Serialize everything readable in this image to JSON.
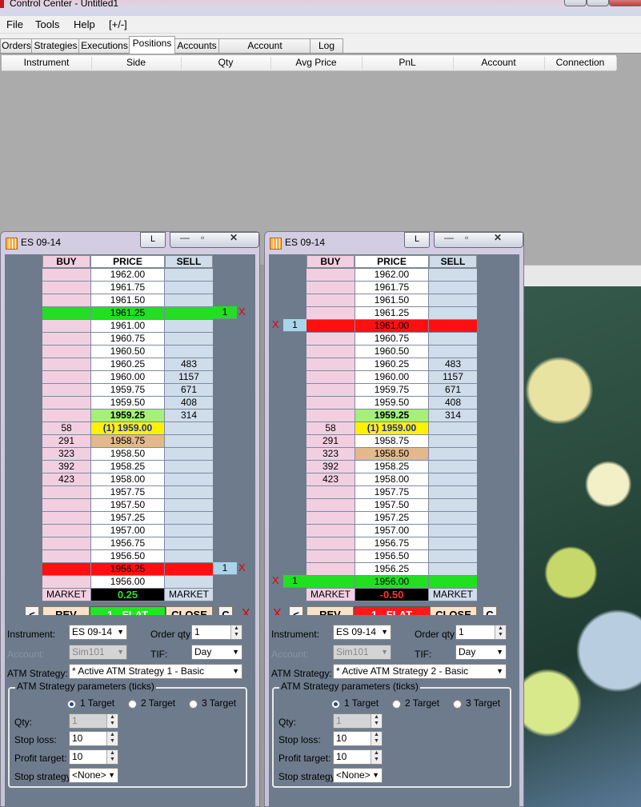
{
  "window": {
    "title": "Control Center - Untitled1"
  },
  "menu": [
    "File",
    "Tools",
    "Help",
    "[+/-]"
  ],
  "tabs": [
    "Orders",
    "Strategies",
    "Executions",
    "Positions",
    "Accounts",
    "Account Performance",
    "Log"
  ],
  "active_tab": "Positions",
  "grid": {
    "columns": [
      "Instrument",
      "Side",
      "Qty",
      "Avg Price",
      "PnL",
      "Account",
      "Connection"
    ]
  },
  "doms": [
    {
      "title": "ES 09-14",
      "lock": "L",
      "headers": {
        "buy": "BUY",
        "price": "PRICE",
        "sell": "SELL"
      },
      "rows": [
        {
          "p": "1962.00",
          "b": "",
          "s": ""
        },
        {
          "p": "1961.75",
          "b": "",
          "s": ""
        },
        {
          "p": "1961.50",
          "b": "",
          "s": ""
        },
        {
          "p": "1961.25",
          "b": "",
          "s": "",
          "hl": "green",
          "right_order": "1"
        },
        {
          "p": "1961.00",
          "b": "",
          "s": ""
        },
        {
          "p": "1960.75",
          "b": "",
          "s": ""
        },
        {
          "p": "1960.50",
          "b": "",
          "s": ""
        },
        {
          "p": "1960.25",
          "b": "",
          "s": "483"
        },
        {
          "p": "1960.00",
          "b": "",
          "s": "1157"
        },
        {
          "p": "1959.75",
          "b": "",
          "s": "671"
        },
        {
          "p": "1959.50",
          "b": "",
          "s": "408"
        },
        {
          "p": "1959.25",
          "b": "",
          "s": "314",
          "pstyle": "ask"
        },
        {
          "p": "(1) 1959.00",
          "b": "58",
          "s": "",
          "pstyle": "last"
        },
        {
          "p": "1958.75",
          "b": "291",
          "s": "",
          "pstyle": "tan"
        },
        {
          "p": "1958.50",
          "b": "323",
          "s": ""
        },
        {
          "p": "1958.25",
          "b": "392",
          "s": ""
        },
        {
          "p": "1958.00",
          "b": "423",
          "s": ""
        },
        {
          "p": "1957.75",
          "b": "",
          "s": ""
        },
        {
          "p": "1957.50",
          "b": "",
          "s": ""
        },
        {
          "p": "1957.25",
          "b": "",
          "s": ""
        },
        {
          "p": "1957.00",
          "b": "",
          "s": ""
        },
        {
          "p": "1956.75",
          "b": "",
          "s": ""
        },
        {
          "p": "1956.50",
          "b": "",
          "s": ""
        },
        {
          "p": "1956.25",
          "b": "",
          "s": "",
          "hl": "red",
          "right_order": "1"
        },
        {
          "p": "1956.00",
          "b": "",
          "s": ""
        }
      ],
      "market_buy": "MARKET",
      "pnl": "0.25",
      "pnl_color": "#2fe02f",
      "market_sell": "MARKET",
      "controls": {
        "left": "<",
        "rev": "REV",
        "flat": "1 - FLAT",
        "flat_bg": "#22e622",
        "close": "CLOSE",
        "c": "C",
        "x": "X",
        "x_side": "right"
      },
      "form": {
        "instrument_label": "Instrument:",
        "instrument": "ES 09-14",
        "orderqty_label": "Order qty:",
        "orderqty": "1",
        "account_label": "Account:",
        "account": "Sim101",
        "tif_label": "TIF:",
        "tif": "Day",
        "atm_label": "ATM Strategy:",
        "atm": "* Active ATM Strategy 1 - Basic",
        "params_title": "ATM Strategy parameters (ticks)",
        "targets": [
          "1 Target",
          "2 Target",
          "3 Target"
        ],
        "qty_label": "Qty:",
        "qty": "1",
        "stoploss_label": "Stop loss:",
        "stoploss": "10",
        "profit_label": "Profit target:",
        "profit": "10",
        "stopstrat_label": "Stop strategy:",
        "stopstrat": "<None>"
      }
    },
    {
      "title": "ES 09-14",
      "lock": "L",
      "headers": {
        "buy": "BUY",
        "price": "PRICE",
        "sell": "SELL"
      },
      "rows": [
        {
          "p": "1962.00",
          "b": "",
          "s": ""
        },
        {
          "p": "1961.75",
          "b": "",
          "s": ""
        },
        {
          "p": "1961.50",
          "b": "",
          "s": ""
        },
        {
          "p": "1961.25",
          "b": "",
          "s": ""
        },
        {
          "p": "1961.00",
          "b": "",
          "s": "",
          "hl": "red",
          "left_order": "1"
        },
        {
          "p": "1960.75",
          "b": "",
          "s": ""
        },
        {
          "p": "1960.50",
          "b": "",
          "s": ""
        },
        {
          "p": "1960.25",
          "b": "",
          "s": "483"
        },
        {
          "p": "1960.00",
          "b": "",
          "s": "1157"
        },
        {
          "p": "1959.75",
          "b": "",
          "s": "671"
        },
        {
          "p": "1959.50",
          "b": "",
          "s": "408"
        },
        {
          "p": "1959.25",
          "b": "",
          "s": "314",
          "pstyle": "ask"
        },
        {
          "p": "(1) 1959.00",
          "b": "58",
          "s": "",
          "pstyle": "last"
        },
        {
          "p": "1958.75",
          "b": "291",
          "s": ""
        },
        {
          "p": "1958.50",
          "b": "323",
          "s": "",
          "pstyle": "tan"
        },
        {
          "p": "1958.25",
          "b": "392",
          "s": ""
        },
        {
          "p": "1958.00",
          "b": "423",
          "s": ""
        },
        {
          "p": "1957.75",
          "b": "",
          "s": ""
        },
        {
          "p": "1957.50",
          "b": "",
          "s": ""
        },
        {
          "p": "1957.25",
          "b": "",
          "s": ""
        },
        {
          "p": "1957.00",
          "b": "",
          "s": ""
        },
        {
          "p": "1956.75",
          "b": "",
          "s": ""
        },
        {
          "p": "1956.50",
          "b": "",
          "s": ""
        },
        {
          "p": "1956.25",
          "b": "",
          "s": ""
        },
        {
          "p": "1956.00",
          "b": "",
          "s": "",
          "hl": "green",
          "left_order": "1"
        }
      ],
      "market_buy": "MARKET",
      "pnl": "-0.50",
      "pnl_color": "#ff3030",
      "market_sell": "MARKET",
      "controls": {
        "left": "<",
        "rev": "REV",
        "flat": "1 - FLAT",
        "flat_bg": "#ff1818",
        "close": "CLOSE",
        "c": "C",
        "x": "X",
        "x_side": "left"
      },
      "form": {
        "instrument_label": "Instrument:",
        "instrument": "ES 09-14",
        "orderqty_label": "Order qty:",
        "orderqty": "1",
        "account_label": "Account:",
        "account": "Sim101",
        "tif_label": "TIF:",
        "tif": "Day",
        "atm_label": "ATM Strategy:",
        "atm": "* Active ATM Strategy 2 - Basic",
        "params_title": "ATM Strategy parameters (ticks)",
        "targets": [
          "1 Target",
          "2 Target",
          "3 Target"
        ],
        "qty_label": "Qty:",
        "qty": "1",
        "stoploss_label": "Stop loss:",
        "stoploss": "10",
        "profit_label": "Profit target:",
        "profit": "10",
        "stopstrat_label": "Stop strategy:",
        "stopstrat": "<None>"
      }
    }
  ]
}
